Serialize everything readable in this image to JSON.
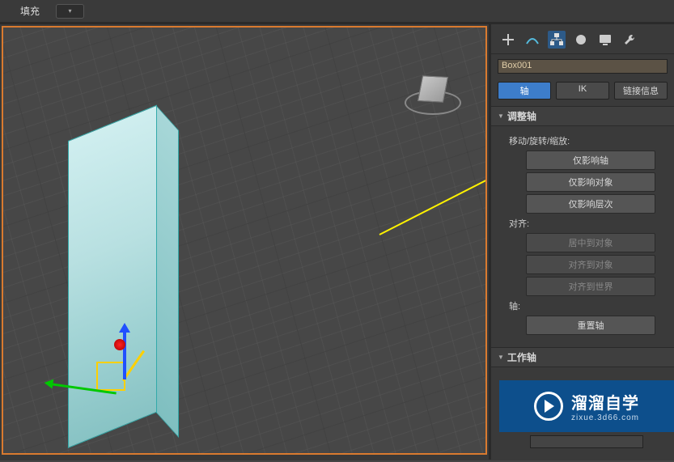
{
  "topbar": {
    "fill_label": "填充",
    "dropdown_icon": "▾"
  },
  "viewport": {
    "object_selected": "Box001"
  },
  "panel": {
    "tabs": {
      "create": "create-icon",
      "modify": "modify-icon",
      "hierarchy": "hierarchy-icon",
      "motion": "motion-icon",
      "display": "display-icon",
      "utilities": "utilities-icon"
    },
    "name_field": "Box001",
    "sub_tabs": {
      "pivot": "轴",
      "ik": "IK",
      "link_info": "链接信息"
    },
    "rollout_adjust": {
      "title": "调整轴",
      "move_group": "移动/旋转/缩放:",
      "btn_affect_pivot": "仅影响轴",
      "btn_affect_object": "仅影响对象",
      "btn_affect_hierarchy": "仅影响层次",
      "align_group": "对齐:",
      "btn_center_to_object": "居中到对象",
      "btn_align_to_object": "对齐到对象",
      "btn_align_to_world": "对齐到世界",
      "axis_group": "轴:",
      "btn_reset_axis": "重置轴"
    },
    "rollout_working": {
      "title": "工作轴"
    }
  },
  "watermark": {
    "title": "溜溜自学",
    "subtitle": "zixue.3d66.com"
  }
}
